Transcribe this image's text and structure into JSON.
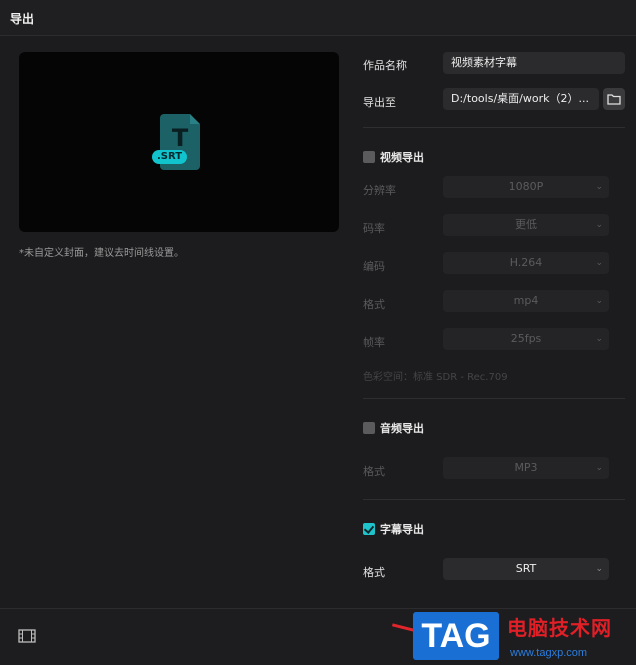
{
  "window": {
    "title": "导出"
  },
  "preview": {
    "badge": ".SRT",
    "letter": "T",
    "icon": "srt-file-icon"
  },
  "cover_note": "*未自定义封面，建议去时间线设置。",
  "fields": {
    "name_label": "作品名称",
    "name_value": "视频素材字幕",
    "path_label": "导出至",
    "path_value": "D:/tools/桌面/work（2）..."
  },
  "video_export": {
    "label": "视频导出",
    "checked": false,
    "resolution_label": "分辨率",
    "resolution_value": "1080P",
    "bitrate_label": "码率",
    "bitrate_value": "更低",
    "codec_label": "编码",
    "codec_value": "H.264",
    "format_label": "格式",
    "format_value": "mp4",
    "fps_label": "帧率",
    "fps_value": "25fps",
    "color_space": "色彩空间：标准 SDR - Rec.709"
  },
  "audio_export": {
    "label": "音频导出",
    "checked": false,
    "format_label": "格式",
    "format_value": "MP3"
  },
  "subtitle_export": {
    "label": "字幕导出",
    "checked": true,
    "format_label": "格式",
    "format_value": "SRT"
  },
  "watermark": {
    "tag": "TAG",
    "site_name": "电脑技术网",
    "url": "www.tagxp.com"
  },
  "colors": {
    "accent": "#1ec3cc",
    "background": "#1c1c1e",
    "watermark_blue": "#1a6fd4",
    "watermark_red": "#e01f27"
  }
}
